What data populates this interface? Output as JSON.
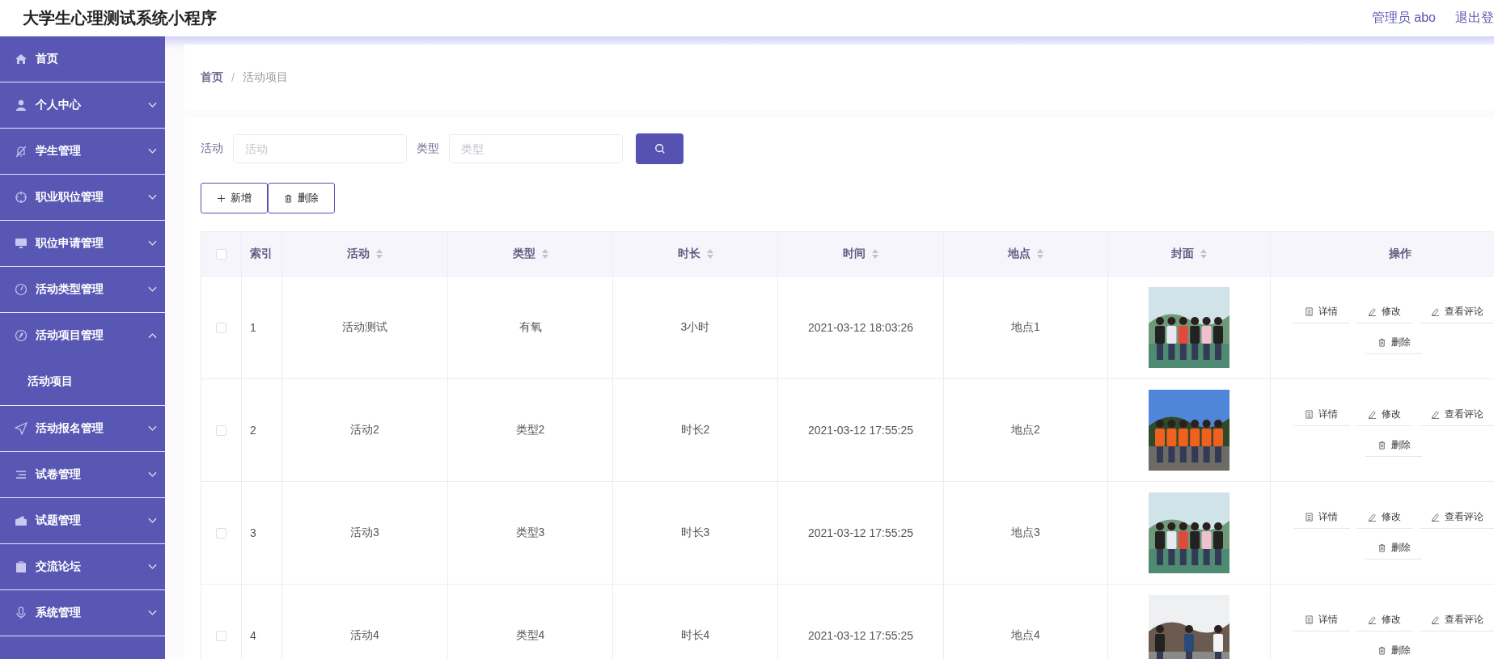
{
  "header": {
    "title": "大学生心理测试系统小程序",
    "user": "管理员 abo",
    "logout": "退出登"
  },
  "sidebar": {
    "items": [
      {
        "label": "首页",
        "kind": "link"
      },
      {
        "label": "个人中心",
        "kind": "menu",
        "expanded": false
      },
      {
        "label": "学生管理",
        "kind": "menu",
        "expanded": false
      },
      {
        "label": "职业职位管理",
        "kind": "menu",
        "expanded": false
      },
      {
        "label": "职位申请管理",
        "kind": "menu",
        "expanded": false
      },
      {
        "label": "活动类型管理",
        "kind": "menu",
        "expanded": false
      },
      {
        "label": "活动项目管理",
        "kind": "menu",
        "expanded": true,
        "children": [
          {
            "label": "活动项目",
            "selected": true
          }
        ]
      },
      {
        "label": "活动报名管理",
        "kind": "menu",
        "expanded": false
      },
      {
        "label": "试卷管理",
        "kind": "menu",
        "expanded": false
      },
      {
        "label": "试题管理",
        "kind": "menu",
        "expanded": false
      },
      {
        "label": "交流论坛",
        "kind": "menu",
        "expanded": false
      },
      {
        "label": "系统管理",
        "kind": "menu",
        "expanded": false
      }
    ]
  },
  "breadcrumb": {
    "separator": "/",
    "items": [
      "首页",
      "活动项目"
    ]
  },
  "search": {
    "fields": [
      {
        "label": "活动",
        "placeholder": "活动"
      },
      {
        "label": "类型",
        "placeholder": "类型"
      }
    ]
  },
  "toolbar": [
    {
      "label": "新增",
      "kind": "add"
    },
    {
      "label": "删除",
      "kind": "delete"
    }
  ],
  "table": {
    "header_checked": false,
    "columns": [
      {
        "label": "索引",
        "sortable": false
      },
      {
        "label": "活动",
        "sortable": true
      },
      {
        "label": "类型",
        "sortable": true
      },
      {
        "label": "时长",
        "sortable": true
      },
      {
        "label": "时间",
        "sortable": true
      },
      {
        "label": "地点",
        "sortable": true
      },
      {
        "label": "封面",
        "sortable": true
      },
      {
        "label": "操作",
        "sortable": false
      }
    ],
    "rows": [
      {
        "checked": false,
        "cells": [
          "1",
          "活动测试",
          "有氧",
          "3小时",
          "2021-03-12 18:03:26",
          "地点1"
        ],
        "actions": [
          "详情",
          "修改",
          "查看评论",
          "删除"
        ]
      },
      {
        "checked": false,
        "cells": [
          "2",
          "活动2",
          "类型2",
          "时长2",
          "2021-03-12 17:55:25",
          "地点2"
        ],
        "actions": [
          "详情",
          "修改",
          "查看评论",
          "删除"
        ]
      },
      {
        "checked": false,
        "cells": [
          "3",
          "活动3",
          "类型3",
          "时长3",
          "2021-03-12 17:55:25",
          "地点3"
        ],
        "actions": [
          "详情",
          "修改",
          "查看评论",
          "删除"
        ]
      },
      {
        "checked": false,
        "cells": [
          "4",
          "活动4",
          "类型4",
          "时长4",
          "2021-03-12 17:55:25",
          "地点4"
        ],
        "actions": [
          "详情",
          "修改",
          "查看评论",
          "删除"
        ]
      }
    ]
  }
}
